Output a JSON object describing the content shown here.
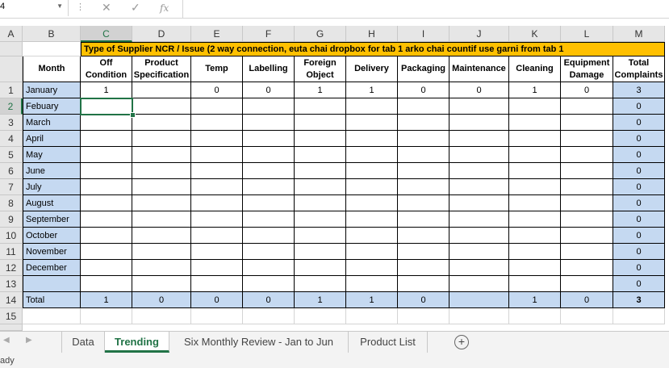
{
  "formula_bar": {
    "name_box": "4",
    "cancel_icon": "✕",
    "enter_icon": "✓",
    "fx_label": "fx"
  },
  "column_letters": [
    "A",
    "B",
    "C",
    "D",
    "E",
    "F",
    "G",
    "H",
    "I",
    "J",
    "K",
    "L",
    "M"
  ],
  "selected_column": "C",
  "banner": "Type of Supplier NCR / Issue (2 way connection, euta chai dropbox for tab 1 arko chai countif use garni from tab 1",
  "headers": {
    "month": "Month",
    "categories": [
      "Off Condition",
      "Product Specification",
      "Temp",
      "Labelling",
      "Foreign Object",
      "Delivery",
      "Packaging",
      "Maintenance",
      "Cleaning",
      "Equipment Damage"
    ],
    "total": "Total Complaints"
  },
  "rows": [
    {
      "n": "1",
      "month": "January",
      "values": [
        "1",
        "",
        "0",
        "0",
        "1",
        "1",
        "0",
        "0",
        "1",
        "0"
      ],
      "total": "3"
    },
    {
      "n": "2",
      "month": "Febuary",
      "values": [
        "",
        "",
        "",
        "",
        "",
        "",
        "",
        "",
        "",
        ""
      ],
      "total": "0"
    },
    {
      "n": "3",
      "month": "March",
      "values": [
        "",
        "",
        "",
        "",
        "",
        "",
        "",
        "",
        "",
        ""
      ],
      "total": "0"
    },
    {
      "n": "4",
      "month": "April",
      "values": [
        "",
        "",
        "",
        "",
        "",
        "",
        "",
        "",
        "",
        ""
      ],
      "total": "0"
    },
    {
      "n": "5",
      "month": "May",
      "values": [
        "",
        "",
        "",
        "",
        "",
        "",
        "",
        "",
        "",
        ""
      ],
      "total": "0"
    },
    {
      "n": "6",
      "month": "June",
      "values": [
        "",
        "",
        "",
        "",
        "",
        "",
        "",
        "",
        "",
        ""
      ],
      "total": "0"
    },
    {
      "n": "7",
      "month": "July",
      "values": [
        "",
        "",
        "",
        "",
        "",
        "",
        "",
        "",
        "",
        ""
      ],
      "total": "0"
    },
    {
      "n": "8",
      "month": "August",
      "values": [
        "",
        "",
        "",
        "",
        "",
        "",
        "",
        "",
        "",
        ""
      ],
      "total": "0"
    },
    {
      "n": "9",
      "month": "September",
      "values": [
        "",
        "",
        "",
        "",
        "",
        "",
        "",
        "",
        "",
        ""
      ],
      "total": "0"
    },
    {
      "n": "10",
      "month": "October",
      "values": [
        "",
        "",
        "",
        "",
        "",
        "",
        "",
        "",
        "",
        ""
      ],
      "total": "0"
    },
    {
      "n": "11",
      "month": "November",
      "values": [
        "",
        "",
        "",
        "",
        "",
        "",
        "",
        "",
        "",
        ""
      ],
      "total": "0"
    },
    {
      "n": "12",
      "month": "December",
      "values": [
        "",
        "",
        "",
        "",
        "",
        "",
        "",
        "",
        "",
        ""
      ],
      "total": "0"
    },
    {
      "n": "13",
      "month": "",
      "values": [
        "",
        "",
        "",
        "",
        "",
        "",
        "",
        "",
        "",
        ""
      ],
      "total": "0"
    }
  ],
  "total_row": {
    "n": "14",
    "label": "Total",
    "values": [
      "1",
      "0",
      "0",
      "0",
      "1",
      "1",
      "0",
      "",
      "1",
      "0"
    ],
    "total": "3"
  },
  "extra_row": "15",
  "sheet_tabs": [
    {
      "label": "Data",
      "active": false
    },
    {
      "label": "Trending",
      "active": true
    },
    {
      "label": "Six Monthly Review - Jan to Jun",
      "active": false
    },
    {
      "label": "Product List",
      "active": false
    }
  ],
  "add_sheet_icon": "+",
  "status_text": "ady",
  "colors": {
    "accent": "#217346",
    "blue_fill": "#c5d9f1",
    "orange_fill": "#ffc000"
  }
}
